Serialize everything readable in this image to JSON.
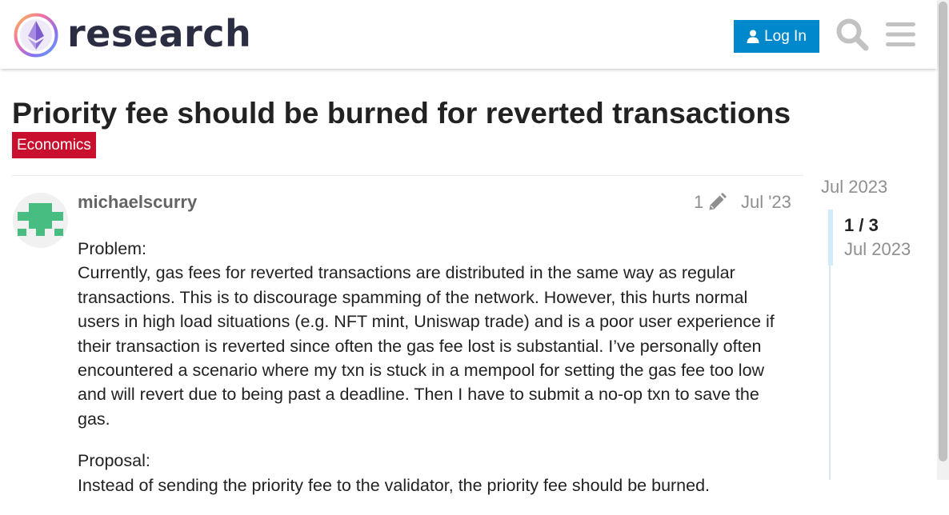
{
  "header": {
    "site_name": "research",
    "login_label": "Log In",
    "icons": [
      "ethereum-logo",
      "user-icon",
      "search-icon",
      "hamburger-menu-icon"
    ]
  },
  "topic": {
    "title": "Priority fee should be burned for reverted transactions",
    "category": "Economics"
  },
  "post": {
    "username": "michaelscurry",
    "edit_count": "1",
    "date": "Jul '23",
    "paragraphs": [
      "Problem:",
      "Currently, gas fees for reverted transactions are distributed in the same way as regular transactions. This is to discourage spamming of the network. However, this hurts normal users in high load situations (e.g. NFT mint, Uniswap trade) and is a poor user experience if their transaction is reverted since often the gas fee lost is substantial. I’ve personally often encountered a scenario where my txn is stuck in a mempool for setting the gas fee too low and will revert due to being past a deadline. Then I have to submit a no-op txn to save the gas.",
      "Proposal:",
      "Instead of sending the priority fee to the validator, the priority fee should be burned."
    ]
  },
  "timeline": {
    "start_date": "Jul 2023",
    "position": "1 / 3",
    "current_date": "Jul 2023"
  },
  "colors": {
    "brand_blue": "#0088cc",
    "category_red": "#c8102e",
    "avatar_green": "#47bd82",
    "muted_text": "#8f8f8f"
  }
}
